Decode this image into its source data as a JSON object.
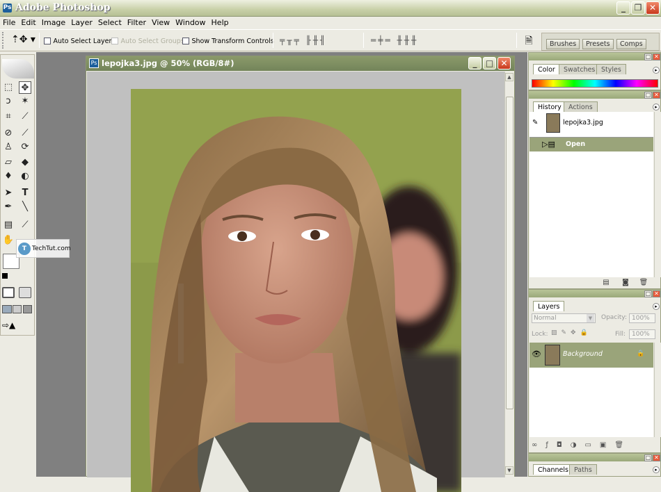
{
  "app": {
    "title": "Adobe Photoshop"
  },
  "menu": [
    "File",
    "Edit",
    "Image",
    "Layer",
    "Select",
    "Filter",
    "View",
    "Window",
    "Help"
  ],
  "options": {
    "auto_select_layer": "Auto Select Layer",
    "auto_select_groups": "Auto Select Groups",
    "show_transform_controls": "Show Transform Controls"
  },
  "palette_well": {
    "tabs": [
      "Brushes",
      "Presets",
      "Comps"
    ]
  },
  "document": {
    "title": "lepojka3.jpg @ 50% (RGB/8#)"
  },
  "color_panel": {
    "tabs": [
      "Color",
      "Swatches",
      "Styles"
    ]
  },
  "history_panel": {
    "tabs": [
      "History",
      "Actions"
    ],
    "snapshot": "lepojka3.jpg",
    "state": "Open"
  },
  "layers_panel": {
    "tab": "Layers",
    "blend_mode": "Normal",
    "opacity_label": "Opacity:",
    "opacity_value": "100%",
    "lock_label": "Lock:",
    "fill_label": "Fill:",
    "fill_value": "100%",
    "layer_name": "Background"
  },
  "bottom_panel": {
    "tabs": [
      "Channels",
      "Paths"
    ]
  },
  "watermark": {
    "text": "TechTut.com"
  }
}
